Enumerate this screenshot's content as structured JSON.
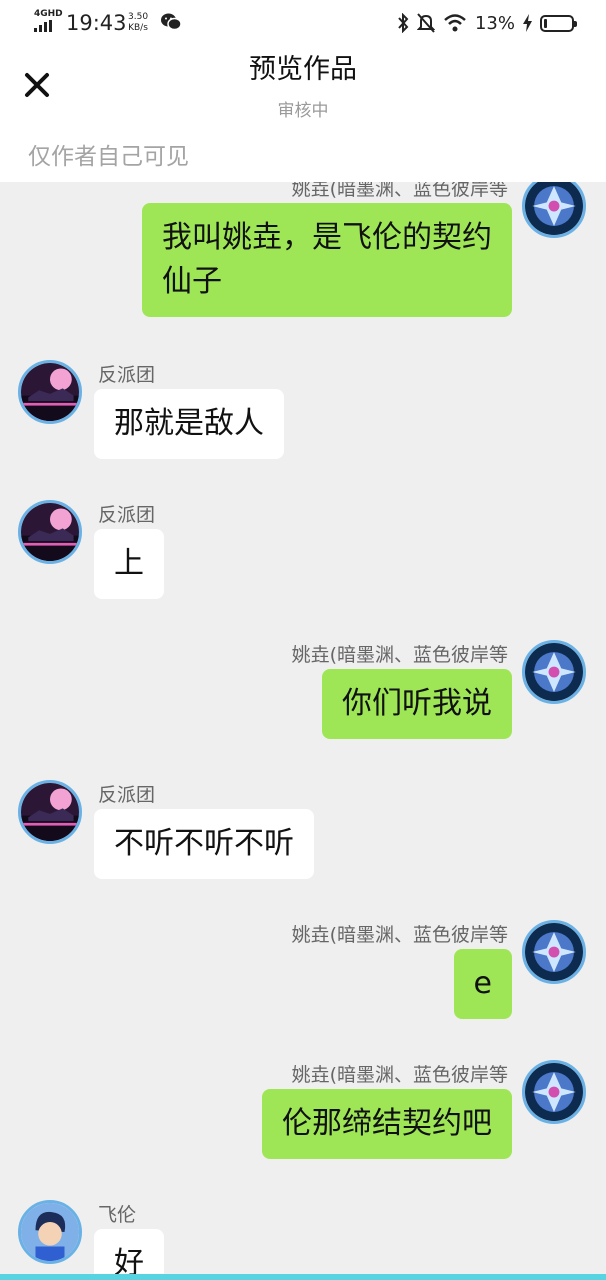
{
  "status_bar": {
    "network": "4GHD",
    "time": "19:43",
    "speed": "3.50",
    "speed_unit": "KB/s",
    "battery": "13%",
    "battery_level": 0.13,
    "icons": [
      "signal-icon",
      "wechat-icon",
      "bluetooth-icon",
      "mute-icon",
      "wifi-icon",
      "battery-icon",
      "charging-icon"
    ]
  },
  "header": {
    "title": "预览作品",
    "subtitle": "审核中",
    "visibility_note": "仅作者自己可见"
  },
  "colors": {
    "own_bubble": "#9fe657",
    "other_bubble": "#ffffff",
    "avatar_ring": "#6ab2e6",
    "background": "#efefef",
    "bottom_bar": "#56d4e1"
  },
  "messages": [
    {
      "side": "right",
      "sender": "姚垚(暗墨渊、蓝色彼岸等",
      "lines": [
        "我叫姚垚，是飞伦的契约",
        "仙子"
      ],
      "avatar": "dragon-avatar"
    },
    {
      "side": "left",
      "sender": "反派团",
      "text": "那就是敌人",
      "avatar": "night-castle-avatar"
    },
    {
      "side": "left",
      "sender": "反派团",
      "text": "上",
      "avatar": "night-castle-avatar"
    },
    {
      "side": "right",
      "sender": "姚垚(暗墨渊、蓝色彼岸等",
      "text": "你们听我说",
      "avatar": "dragon-avatar"
    },
    {
      "side": "left",
      "sender": "反派团",
      "text": "不听不听不听",
      "avatar": "night-castle-avatar"
    },
    {
      "side": "right",
      "sender": "姚垚(暗墨渊、蓝色彼岸等",
      "text": "e",
      "avatar": "dragon-avatar"
    },
    {
      "side": "right",
      "sender": "姚垚(暗墨渊、蓝色彼岸等",
      "text": "伦那缔结契约吧",
      "avatar": "dragon-avatar"
    },
    {
      "side": "left",
      "sender": "飞伦",
      "text": "好",
      "avatar": "boy-hero-avatar"
    }
  ]
}
